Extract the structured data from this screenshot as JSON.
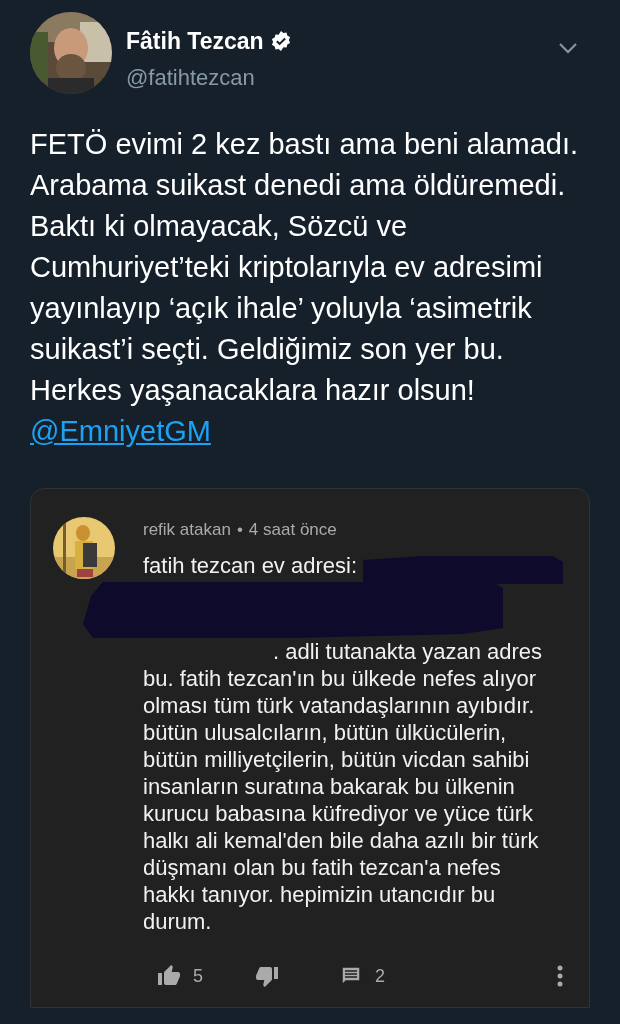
{
  "author": {
    "name": "Fâtih Tezcan",
    "handle": "@fatihtezcan",
    "verified": true
  },
  "tweet": {
    "text": "FETÖ evimi 2 kez bastı ama beni alamadı. Arabama suikast denedi ama öldüremedi. Baktı ki olmayacak, Sözcü ve Cumhuriyet’teki kriptolarıyla ev adresimi yayınlayıp ‘açık ihale’ yoluyla ‘asimetrik suikast’i seçti. Geldiğimiz son yer bu. Herkes yaşanacaklara hazır olsun!",
    "mention": "@EmniyetGM"
  },
  "comment": {
    "user": "refik atakan",
    "separator": "•",
    "time": "4 saat önce",
    "first_line": "fatih tezcan ev adresi:",
    "body": ". adli tutanakta yazan adres bu. fatih tezcan'ın bu ülkede nefes alıyor olması tüm türk vatandaşlarının ayıbıdır. bütün ulusalcıların, bütün ülkücülerin, bütün milliyetçilerin, bütün vicdan sahibi insanların suratına bakarak bu ülkenin kurucu babasına küfrediyor ve yüce türk halkı ali kemal'den bile daha azılı bir türk düşmanı olan bu fatih tezcan'a nefes hakkı tanıyor. hepimizin utancıdır bu durum.",
    "likes": "5",
    "replies": "2"
  }
}
